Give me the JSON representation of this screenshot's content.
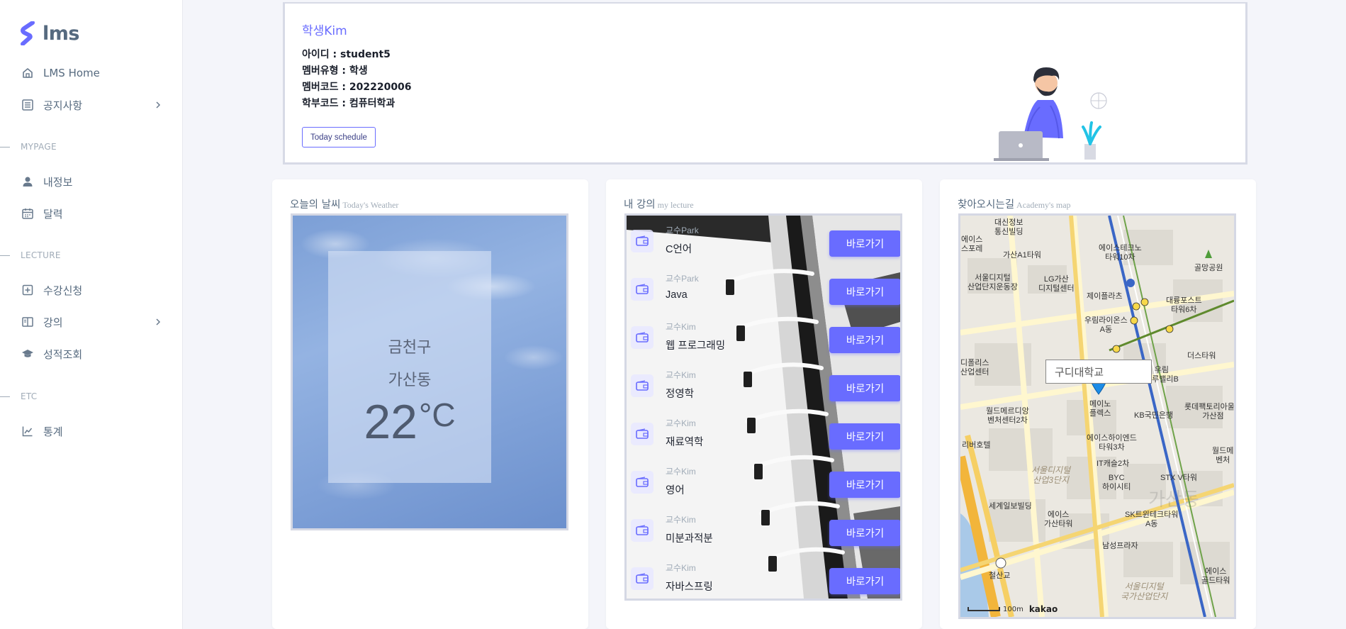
{
  "sidebar": {
    "brand": "lms",
    "items": [
      {
        "label": "LMS Home",
        "icon": "home-icon"
      },
      {
        "label": "공지사항",
        "icon": "list-icon"
      },
      {
        "label": "내정보",
        "icon": "user-icon"
      },
      {
        "label": "달력",
        "icon": "calendar-icon"
      },
      {
        "label": "수강신청",
        "icon": "add-box-icon"
      },
      {
        "label": "강의",
        "icon": "book-icon"
      },
      {
        "label": "성적조회",
        "icon": "graduation-cap-icon"
      },
      {
        "label": "통계",
        "icon": "line-chart-icon"
      }
    ],
    "sections": {
      "mypage": "MYPAGE",
      "lecture": "LECTURE",
      "etc": "ETC"
    }
  },
  "profile": {
    "title_prefix": "학생",
    "title_name": "Kim",
    "lines": [
      "아이디 : student5",
      "멤버유형 : 학생",
      "멤버코드 : 202220006",
      "학부코드 : 컴퓨터학과"
    ],
    "button": "Today schedule"
  },
  "weather": {
    "title": "오늘의 날씨",
    "subtitle": "Today's Weather",
    "district": "금천구",
    "dong": "가산동",
    "temp": "22",
    "unit": "°C"
  },
  "lecture": {
    "title": "내 강의",
    "subtitle": "my lecture",
    "button_label": "바로가기",
    "rows": [
      {
        "prof": "교수Park",
        "name": "C언어"
      },
      {
        "prof": "교수Park",
        "name": "Java"
      },
      {
        "prof": "교수Kim",
        "name": "웹 프로그래밍"
      },
      {
        "prof": "교수Kim",
        "name": "정영학"
      },
      {
        "prof": "교수Kim",
        "name": "재료역학"
      },
      {
        "prof": "교수Kim",
        "name": "영어"
      },
      {
        "prof": "교수Kim",
        "name": "미분과적분"
      },
      {
        "prof": "교수Kim",
        "name": "자바스프링"
      }
    ]
  },
  "map": {
    "title": "찾아오시는길",
    "subtitle": "Academy's map",
    "popup": "구디대학교",
    "scale": "100m",
    "provider": "kakao",
    "labels": [
      "대신정보\n통신빌딩",
      "에이스\n스포레",
      "가산A1타워",
      "에이스테크노\n타워10차",
      "골망공원",
      "서울디지털\n산업단지운동장",
      "LG가산\n디지털센터",
      "제이플라츠",
      "대륭포스트\n타워6차",
      "우림라이온스\nA동",
      "더스타워",
      "디폴리스\n산업센터",
      "우림\n블루밸리B",
      "월드메르디앙\n벤처센터2차",
      "메이노\n플렉스",
      "KB국민은행",
      "롯데팩토리아울렛\n가산점",
      "리버호텔",
      "에이스하이엔드\n타워3차",
      "월드메\n벤처",
      "IT캐슬2차",
      "BYC\n하이시티",
      "STX V타워",
      "세계일보빌딩",
      "에이스\n가산타워",
      "SK트윈테크타워\nA동",
      "남성프라자",
      "철산교",
      "에이스\n골드타워"
    ],
    "districts": [
      "서울디지털\n산업3단지",
      "서울디지털\n국가산업단지"
    ],
    "ghost": "가산동"
  }
}
